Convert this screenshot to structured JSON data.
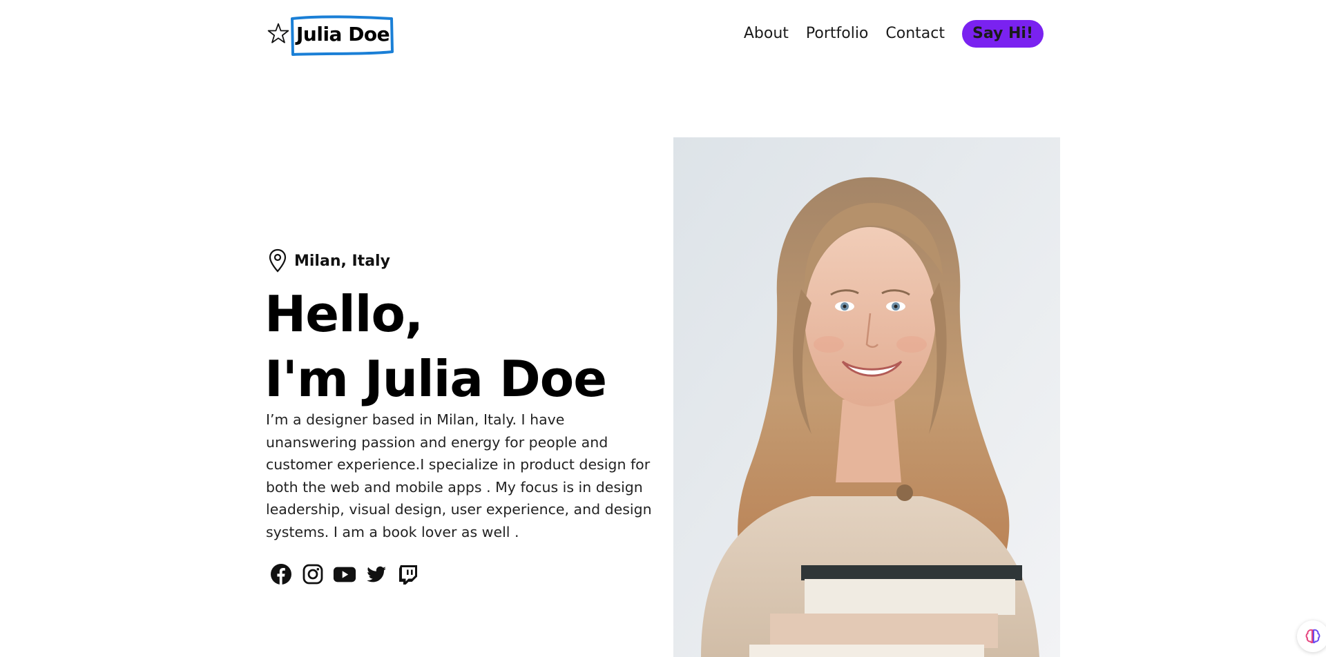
{
  "brand": {
    "name": "Julia Doe",
    "logo_icon": "star-icon",
    "frame_color": "#1a7fd6"
  },
  "nav": {
    "items": [
      "About",
      "Portfolio",
      "Contact"
    ],
    "cta_label": "Say Hi!",
    "cta_color": "#7a22f0"
  },
  "hero": {
    "location": "Milan, Italy",
    "location_icon": "map-pin-icon",
    "greeting": "Hello,",
    "name_line": "I'm Julia Doe",
    "bio": "I’m a designer based in Milan, Italy. I have unanswering passion and energy for people and customer experience.I specialize in product design for both the web and mobile apps . My focus is in design leadership, visual design, user experience, and design systems. I am a book lover as well ."
  },
  "socials": [
    {
      "icon": "facebook-icon"
    },
    {
      "icon": "instagram-icon"
    },
    {
      "icon": "youtube-icon"
    },
    {
      "icon": "twitter-icon"
    },
    {
      "icon": "twitch-icon"
    }
  ],
  "photo": {
    "icon": "portrait-photo"
  },
  "widget": {
    "icon": "brain-icon"
  }
}
